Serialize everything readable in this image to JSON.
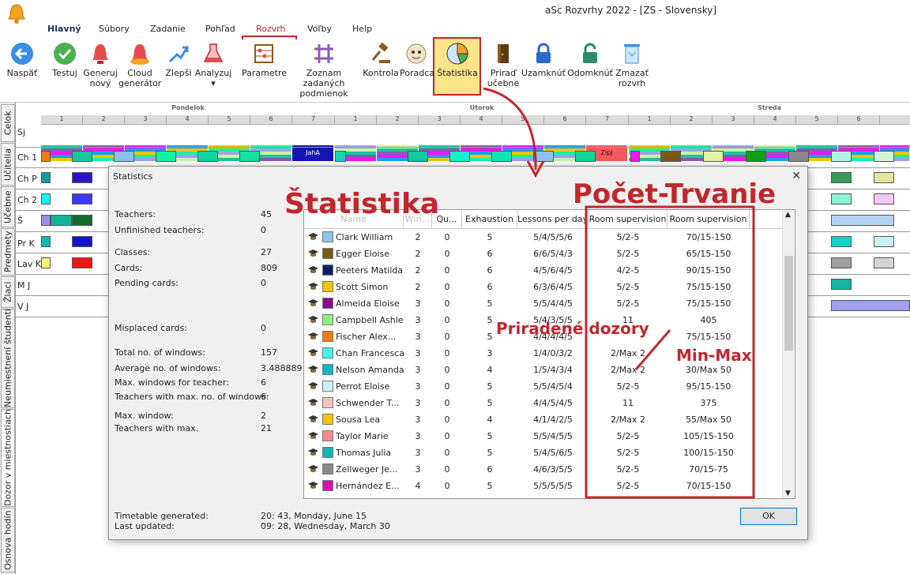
{
  "app": {
    "title": "aSc Rozvrhy 2022  - [ZS - Slovensky]"
  },
  "menu": [
    "Hlavný",
    "Súbory",
    "Zadanie",
    "Pohľad",
    "Rozvrh",
    "Voľby",
    "Help"
  ],
  "ribbon": {
    "buttons": [
      {
        "label1": "Naspäť",
        "label2": ""
      },
      {
        "label1": "Testuj",
        "label2": ""
      },
      {
        "label1": "Generuj",
        "label2": "nový"
      },
      {
        "label1": "Cloud",
        "label2": "generátor"
      },
      {
        "label1": "Zlepši",
        "label2": ""
      },
      {
        "label1": "Analyzuj",
        "label2": ""
      },
      {
        "label1": "Parametre",
        "label2": ""
      },
      {
        "label1": "Zoznam zadaných",
        "label2": "podmienok"
      },
      {
        "label1": "Kontrola",
        "label2": ""
      },
      {
        "label1": "Poradca",
        "label2": ""
      },
      {
        "label1": "Štatistika",
        "label2": ""
      },
      {
        "label1": "Priraď",
        "label2": "učebne"
      },
      {
        "label1": "Uzamknúť",
        "label2": ""
      },
      {
        "label1": "Odomknúť",
        "label2": ""
      },
      {
        "label1": "Zmazať",
        "label2": "rozvrh"
      }
    ],
    "icons": [
      "arrow-back-icon",
      "check-icon",
      "bell-icon",
      "cloud-bell-icon",
      "improve-icon",
      "flask-icon",
      "abacus-icon",
      "grid-icon",
      "gavel-icon",
      "advisor-icon",
      "pie-chart-icon",
      "door-icon",
      "lock-icon",
      "unlock-icon",
      "recycle-icon"
    ]
  },
  "side_tabs": [
    "Celok",
    "Učitelia",
    "Učebne",
    "Predmety",
    "Žiaci",
    "Neumiestnení študenti",
    "Dozor v miestnostiach",
    "Osnova hodín"
  ],
  "timetable": {
    "days": [
      "Pondelok",
      "Utorok",
      "Streda"
    ],
    "periods": [
      "1",
      "2",
      "3",
      "4",
      "5",
      "6",
      "7"
    ],
    "rows": [
      "Sj",
      "Ch 1",
      "Ch P",
      "Ch 2",
      "Š",
      "Pr K",
      "Lav K",
      "M J",
      "V J"
    ],
    "sj_tags": [
      "ZipJ",
      "JahA",
      "ZipJ"
    ]
  },
  "dialog": {
    "title": "Statistics",
    "close": "✕",
    "stats": [
      {
        "label": "Teachers:",
        "value": "45"
      },
      {
        "label": "Unfinished teachers:",
        "value": "0"
      },
      {
        "label": "Classes:",
        "value": "27"
      },
      {
        "label": "Cards:",
        "value": "809"
      },
      {
        "label": "Pending cards:",
        "value": "0"
      },
      {
        "label": "Misplaced cards:",
        "value": "0"
      },
      {
        "label": "Total no. of  windows:",
        "value": "157"
      },
      {
        "label": "Average no. of windows:",
        "value": "3.488889"
      },
      {
        "label": "Max. windows for teacher:",
        "value": "6"
      },
      {
        "label": "Teachers with max. no. of windows:",
        "value": "6"
      },
      {
        "label": "Max. window:",
        "value": "2"
      },
      {
        "label": "Teachers with max.",
        "value": "21"
      }
    ],
    "footer": [
      {
        "label": "Timetable generated:",
        "value": "20: 43, Monday, June 15"
      },
      {
        "label": "Last updated:",
        "value": "09: 28, Wednesday, March 30"
      }
    ],
    "columns": [
      "Name",
      "Win...",
      "Qu...",
      "Exhaustion",
      "Lessons per day",
      "Room supervision",
      "Room supervision"
    ],
    "rows": [
      {
        "name": "Clark William",
        "color": "#8cc4f0",
        "win": "2",
        "qu": "0",
        "ex": "5",
        "lpd": "5/4/5/5/6",
        "rs1": "5/2-5",
        "rs2": "70/15-150"
      },
      {
        "name": "Egger Eloise",
        "color": "#7a5a14",
        "win": "2",
        "qu": "0",
        "ex": "6",
        "lpd": "6/6/5/4/3",
        "rs1": "5/2-5",
        "rs2": "65/15-150"
      },
      {
        "name": "Peeters Matilda",
        "color": "#0a1f6a",
        "win": "2",
        "qu": "0",
        "ex": "6",
        "lpd": "4/5/6/4/5",
        "rs1": "4/2-5",
        "rs2": "90/15-150"
      },
      {
        "name": "Scott Simon",
        "color": "#f4c400",
        "win": "2",
        "qu": "0",
        "ex": "6",
        "lpd": "6/3/6/4/5",
        "rs1": "5/2-5",
        "rs2": "75/15-150"
      },
      {
        "name": "Almeida Eloise",
        "color": "#8a0a8a",
        "win": "3",
        "qu": "0",
        "ex": "5",
        "lpd": "5/5/4/4/5",
        "rs1": "5/2-5",
        "rs2": "75/15-150"
      },
      {
        "name": "Campbell Ashley",
        "color": "#8ef07a",
        "win": "3",
        "qu": "0",
        "ex": "5",
        "lpd": "5/4/3/5/5",
        "rs1": "11",
        "rs2": "405"
      },
      {
        "name": "Fischer Alex...",
        "color": "#f07a14",
        "win": "3",
        "qu": "0",
        "ex": "5",
        "lpd": "4/4/4/4/5",
        "rs1": "",
        "rs2": "75/15-150"
      },
      {
        "name": "Chan Francesca",
        "color": "#3ef4f4",
        "win": "3",
        "qu": "0",
        "ex": "3",
        "lpd": "1/4/0/3/2",
        "rs1": "2/Max 2",
        "rs2": "..."
      },
      {
        "name": "Nelson Amanda",
        "color": "#14b4c8",
        "win": "3",
        "qu": "0",
        "ex": "4",
        "lpd": "1/5/4/3/4",
        "rs1": "2/Max 2",
        "rs2": "30/Max 50"
      },
      {
        "name": "Perrot Eloise",
        "color": "#c8f4fa",
        "win": "3",
        "qu": "0",
        "ex": "5",
        "lpd": "5/5/4/5/4",
        "rs1": "5/2-5",
        "rs2": "95/15-150"
      },
      {
        "name": "Schwender T...",
        "color": "#f4c0c0",
        "win": "3",
        "qu": "0",
        "ex": "5",
        "lpd": "4/4/5/4/5",
        "rs1": "11",
        "rs2": "375"
      },
      {
        "name": "Sousa Lea",
        "color": "#f4c400",
        "win": "3",
        "qu": "0",
        "ex": "4",
        "lpd": "4/1/4/2/5",
        "rs1": "2/Max 2",
        "rs2": "55/Max 50"
      },
      {
        "name": "Taylor Marie",
        "color": "#f48a8a",
        "win": "3",
        "qu": "0",
        "ex": "5",
        "lpd": "5/5/4/5/5",
        "rs1": "5/2-5",
        "rs2": "105/15-150"
      },
      {
        "name": "Thomas Julia",
        "color": "#14b4b4",
        "win": "3",
        "qu": "0",
        "ex": "5",
        "lpd": "5/4/5/6/5",
        "rs1": "5/2-5",
        "rs2": "100/15-150"
      },
      {
        "name": "Zellweger Je...",
        "color": "#8a8a8a",
        "win": "3",
        "qu": "0",
        "ex": "6",
        "lpd": "4/6/3/5/5",
        "rs1": "5/2-5",
        "rs2": "70/15-75"
      },
      {
        "name": "Hernández E...",
        "color": "#d414a8",
        "win": "4",
        "qu": "0",
        "ex": "5",
        "lpd": "5/5/5/5/5",
        "rs1": "5/2-5",
        "rs2": "70/15-150"
      }
    ],
    "ok": "OK"
  },
  "annotations": {
    "statistika": "Štatistika",
    "pocet": "Počet-Trvanie",
    "priradene": "Priradené dozory",
    "minmax": "Min-Max"
  },
  "colors": {
    "accent": "#c0272d",
    "highlight": "#fde38a"
  }
}
